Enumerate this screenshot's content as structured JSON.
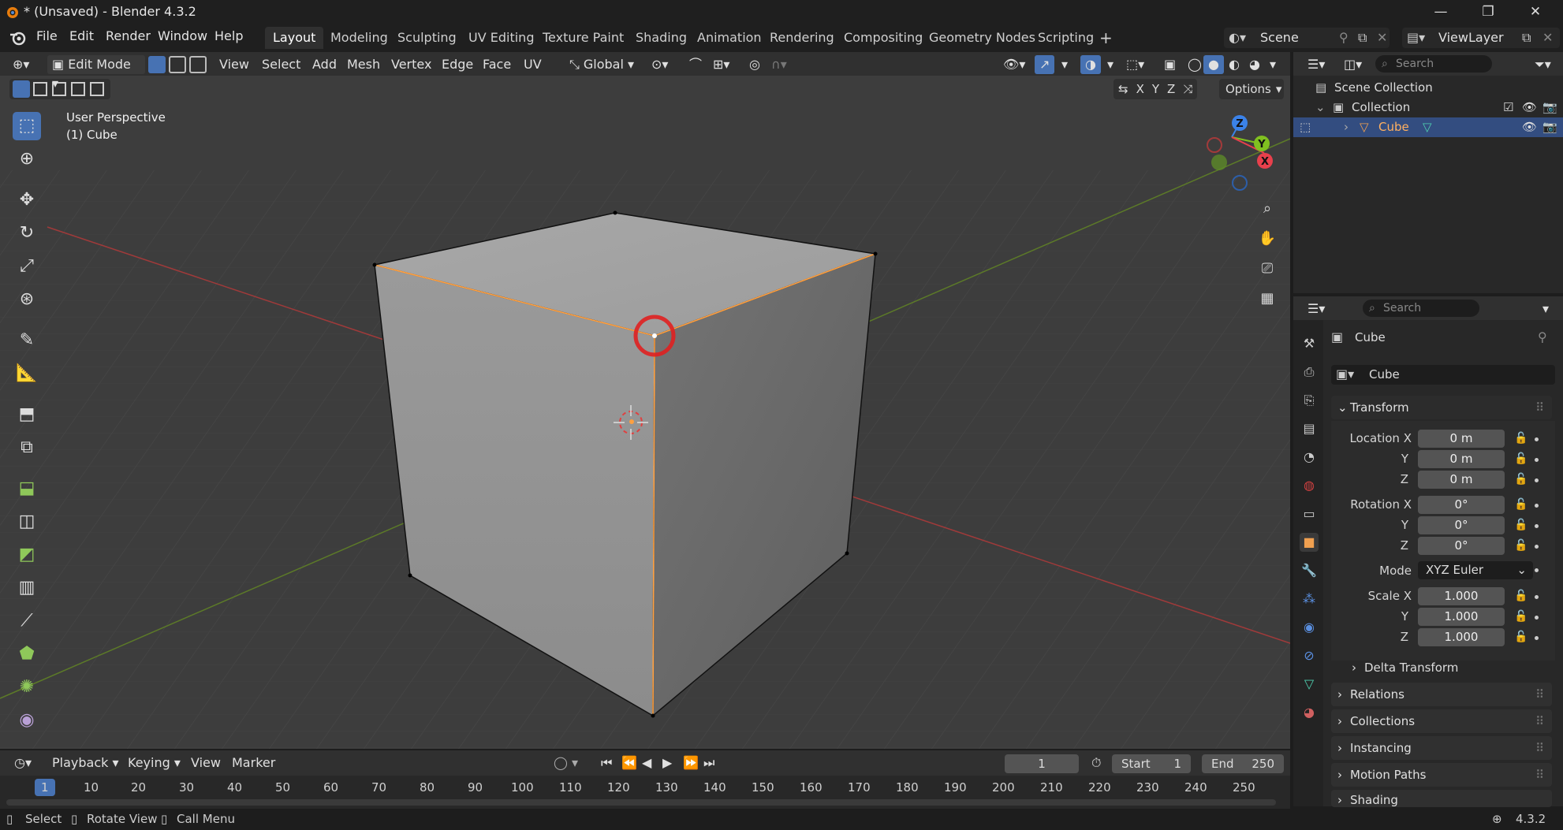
{
  "window": {
    "title": "* (Unsaved) - Blender 4.3.2",
    "minimize": "—",
    "maximize": "❐",
    "close": "✕"
  },
  "menu": {
    "file": "File",
    "edit": "Edit",
    "render": "Render",
    "window": "Window",
    "help": "Help"
  },
  "workspaces": [
    "Layout",
    "Modeling",
    "Sculpting",
    "UV Editing",
    "Texture Paint",
    "Shading",
    "Animation",
    "Rendering",
    "Compositing",
    "Geometry Nodes",
    "Scripting"
  ],
  "workspace_add": "+",
  "scene": {
    "name": "Scene",
    "viewlayer": "ViewLayer"
  },
  "viewport_header": {
    "mode": "Edit Mode",
    "menus": [
      "View",
      "Select",
      "Add",
      "Mesh",
      "Vertex",
      "Edge",
      "Face",
      "UV"
    ],
    "orientation": "Global",
    "options": "Options",
    "axis_x": "X",
    "axis_y": "Y",
    "axis_z": "Z"
  },
  "viewport": {
    "perspective": "User Perspective",
    "object": "(1) Cube",
    "gizmo": {
      "x": "X",
      "y": "Y",
      "z": "Z"
    }
  },
  "outliner": {
    "search_placeholder": "Search",
    "scene_collection": "Scene Collection",
    "collection": "Collection",
    "cube": "Cube"
  },
  "properties": {
    "search_placeholder": "Search",
    "object_name": "Cube",
    "object_field": "Cube",
    "transform": "Transform",
    "location_label": "Location X",
    "y_label": "Y",
    "z_label": "Z",
    "rotation_label": "Rotation X",
    "mode_label": "Mode",
    "scale_label": "Scale X",
    "location": [
      "0 m",
      "0 m",
      "0 m"
    ],
    "rotation": [
      "0°",
      "0°",
      "0°"
    ],
    "mode": "XYZ Euler",
    "scale": [
      "1.000",
      "1.000",
      "1.000"
    ],
    "panels": [
      "Delta Transform",
      "Relations",
      "Collections",
      "Instancing",
      "Motion Paths",
      "Shading"
    ]
  },
  "timeline": {
    "playback": "Playback",
    "keying": "Keying",
    "view": "View",
    "marker": "Marker",
    "current_frame": "1",
    "start_label": "Start",
    "start": "1",
    "end_label": "End",
    "end": "250",
    "ticks": [
      "1",
      "10",
      "20",
      "30",
      "40",
      "50",
      "60",
      "70",
      "80",
      "90",
      "100",
      "110",
      "120",
      "130",
      "140",
      "150",
      "160",
      "170",
      "180",
      "190",
      "200",
      "210",
      "220",
      "230",
      "240",
      "250"
    ]
  },
  "statusbar": {
    "select": "Select",
    "rotate": "Rotate View",
    "call_menu": "Call Menu",
    "version": "4.3.2"
  },
  "colors": {
    "accent": "#4772b3",
    "selected_edge": "#ffa040",
    "highlight_ring": "#e02020",
    "x_axis": "#e8404c",
    "y_axis": "#80c020",
    "z_axis": "#3b82e8"
  }
}
